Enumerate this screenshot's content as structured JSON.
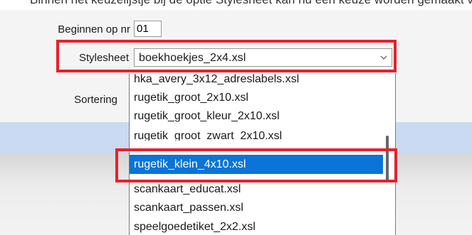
{
  "top_text": "Binnen het keuzelijstje bij de optie Stylesheet kan nu een keuze worden gemaakt voor de gewenste lay-out van de etiketten.",
  "form": {
    "begin_label": "Beginnen op nr",
    "begin_value": "01",
    "stylesheet_label": "Stylesheet",
    "stylesheet_value": "boekhoekjes_2x4.xsl",
    "sort_label": "Sortering"
  },
  "dropdown": {
    "options": [
      "hka_avery_3x12_adreslabels.xsl",
      "rugetik_groot_2x10.xsl",
      "rugetik_groot_kleur_2x10.xsl",
      "rugetik_groot_zwart_2x10.xsl",
      "rugetik_klein_4x10.xsl",
      "scankaart_educat.xsl",
      "scankaart_passen.xsl",
      "speelgoedetiket_2x2.xsl"
    ],
    "selected_index": 4
  },
  "icons": {
    "combo_arrow": "chevron-down-icon"
  },
  "colors": {
    "highlight": "#e8202a",
    "selection": "#0a74d8",
    "band": "#c9daf2"
  }
}
